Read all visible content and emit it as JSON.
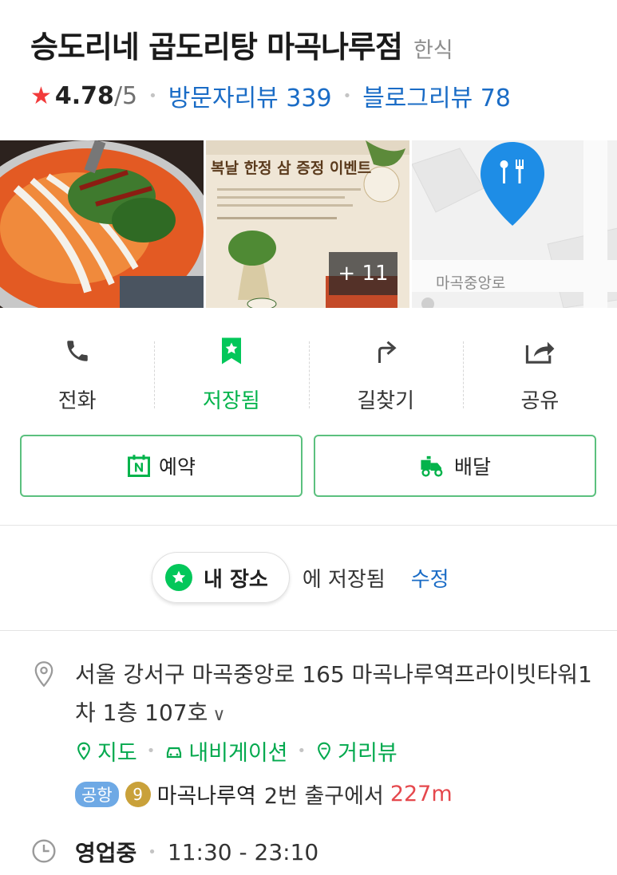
{
  "place": {
    "name": "승도리네 곱도리탕 마곡나루점",
    "category": "한식",
    "rating_value": "4.78",
    "rating_max": "/5",
    "visitor_reviews": "방문자리뷰 339",
    "blog_reviews": "블로그리뷰 78"
  },
  "photos": {
    "promo_title": "복날 한정 삼 증정 이벤트",
    "more_count": "+ 11",
    "map_road_label": "마곡중앙로"
  },
  "actions": [
    {
      "label": "전화",
      "icon": "phone-icon"
    },
    {
      "label": "저장됨",
      "icon": "bookmark-star-icon"
    },
    {
      "label": "길찾기",
      "icon": "directions-icon"
    },
    {
      "label": "공유",
      "icon": "share-icon"
    }
  ],
  "buttons": {
    "reserve": "예약",
    "delivery": "배달"
  },
  "saved": {
    "list_name": "내 장소",
    "saved_text": "에 저장됨",
    "edit": "수정"
  },
  "info": {
    "address": "서울 강서구 마곡중앙로 165 마곡나루역프라이빗타워1차 1층 107호",
    "address_toggle": "∨",
    "map_link": "지도",
    "navi_link": "내비게이션",
    "street_link": "거리뷰",
    "airport_badge": "공항",
    "line_number": "9",
    "station": "마곡나루역",
    "exit_text": "2번 출구에서",
    "distance": "227m",
    "open_status": "영업중",
    "hours": "11:30 - 23:10"
  },
  "colors": {
    "accent_green": "#03c75a",
    "link_blue": "#1a6cc6",
    "rating_red": "#f23b3b",
    "distance_red": "#e5484d"
  }
}
